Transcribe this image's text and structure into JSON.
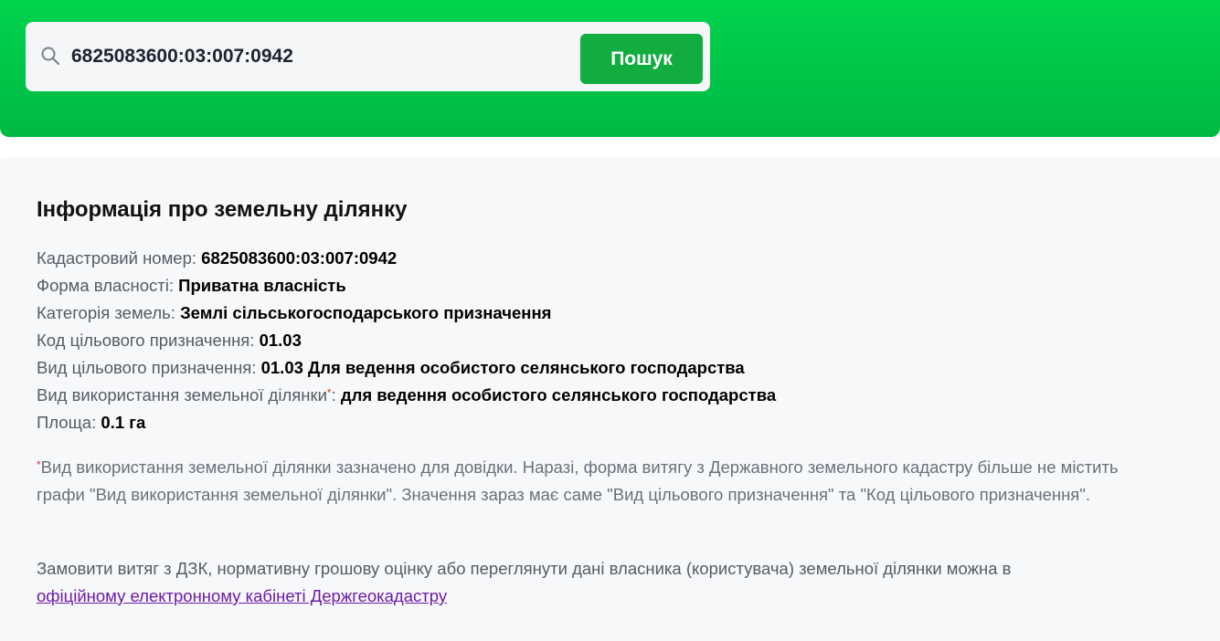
{
  "search": {
    "value": "6825083600:03:007:0942",
    "button_label": "Пошук"
  },
  "info": {
    "title": "Інформація про земельну ділянку",
    "fields": [
      {
        "label": "Кадастровий номер:",
        "value": "6825083600:03:007:0942"
      },
      {
        "label": "Форма власності:",
        "value": "Приватна власність"
      },
      {
        "label": "Категорія земель:",
        "value": "Землі сільськогосподарського призначення"
      },
      {
        "label": "Код цільового призначення:",
        "value": "01.03"
      },
      {
        "label": "Вид цільового призначення:",
        "value": "01.03 Для ведення особистого селянського господарства"
      },
      {
        "label": "Вид використання земельної ділянки",
        "asterisk": "*",
        "suffix": ":",
        "value": "для ведення особистого селянського господарства"
      },
      {
        "label": "Площа:",
        "value": "0.1 га"
      }
    ],
    "note_asterisk": "*",
    "note": "Вид використання земельної ділянки зазначено для довідки. Наразі, форма витягу з Державного земельного кадастру більше не містить графи \"Вид використання земельної ділянки\". Значення зараз має саме \"Вид цільового призначення\" та \"Код цільового призначення\".",
    "order_text": "Замовити витяг з ДЗК, нормативну грошову оцінку або переглянути дані власника (користувача) земельної ділянки можна в",
    "order_link": "офіційному електронному кабінеті Держгеокадастру"
  },
  "colors": {
    "header_green": "#00c94a",
    "button_green": "#12ad40",
    "link_purple": "#6e1aa6",
    "asterisk_red": "#e22c2c"
  },
  "icons": {
    "search": "search-icon"
  }
}
